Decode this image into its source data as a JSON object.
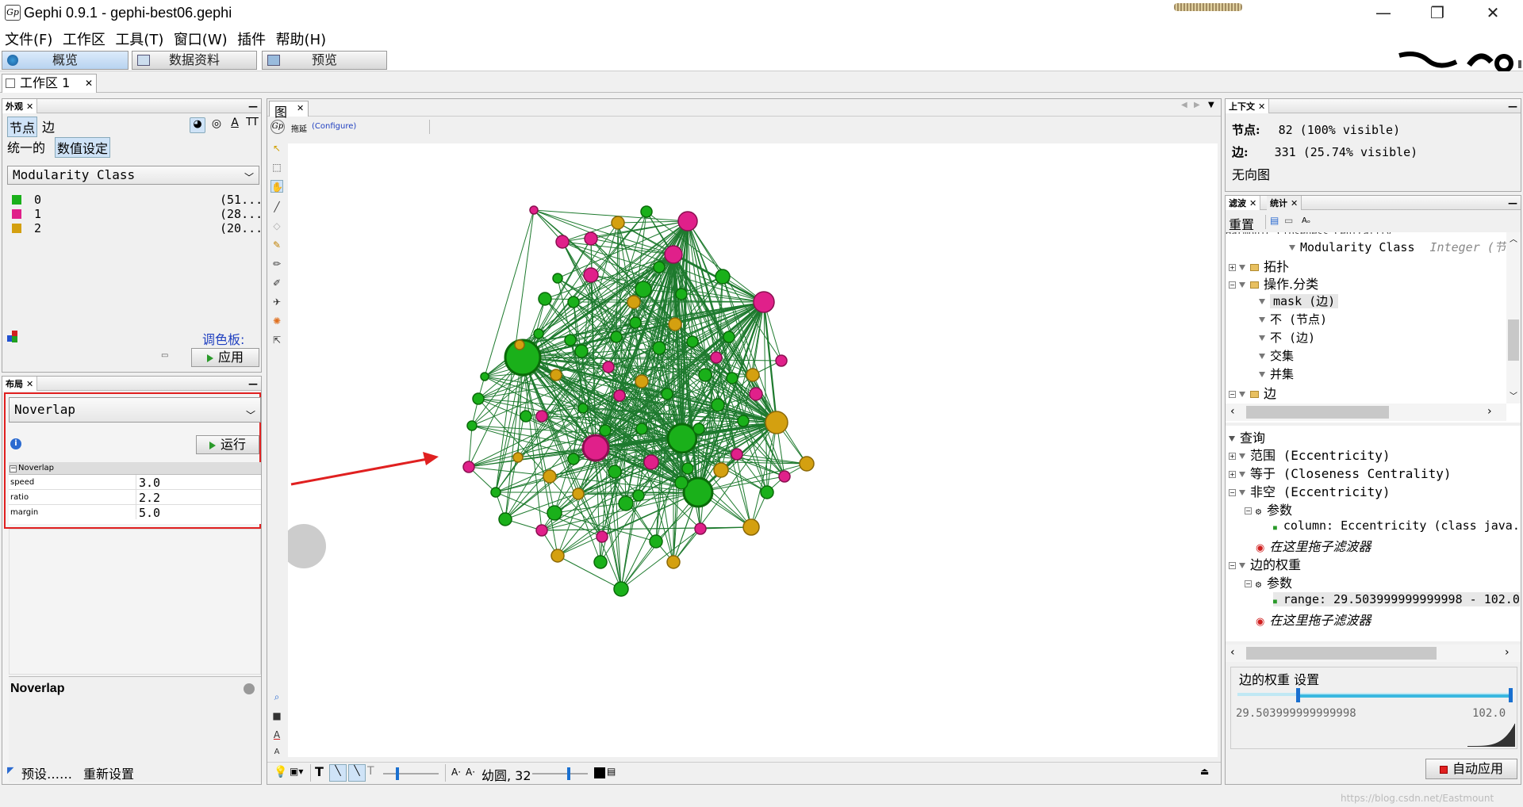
{
  "window": {
    "title": "Gephi 0.9.1 - gephi-best06.gephi",
    "minimize": "—",
    "maximize": "❐",
    "close": "✕"
  },
  "menu": [
    "文件(F)",
    "工作区",
    "工具(T)",
    "窗口(W)",
    "插件",
    "帮助(H)"
  ],
  "top_tabs": {
    "overview": "概览",
    "data": "数据资料",
    "preview": "预览"
  },
  "workspace_tab": "工作区 1",
  "appearance": {
    "title": "外观",
    "tab_nodes": "节点",
    "tab_edges": "边",
    "mode_unique": "统一的",
    "mode_partition": "数值设定",
    "attribute": "Modularity Class",
    "partitions": [
      {
        "label": "0",
        "value": "(51...",
        "color": "#1ab01a"
      },
      {
        "label": "1",
        "value": "(28...",
        "color": "#e0208a"
      },
      {
        "label": "2",
        "value": "(20...",
        "color": "#d4a010"
      }
    ],
    "palette_label": "调色板:",
    "apply": "应用"
  },
  "layout": {
    "title": "布局",
    "algorithm": "Noverlap",
    "run": "运行",
    "group": "Noverlap",
    "params": [
      {
        "name": "speed",
        "value": "3.0"
      },
      {
        "name": "ratio",
        "value": "2.2"
      },
      {
        "name": "margin",
        "value": "5.0"
      }
    ],
    "desc_title": "Noverlap",
    "presets": "预设……",
    "reset": "重新设置"
  },
  "graph": {
    "tab": "图",
    "drag_label": "拖延",
    "configure": "(Configure)",
    "label_font": "幼圆, 32"
  },
  "context": {
    "title": "上下文",
    "nodes_label": "节点:",
    "nodes_value": "82 (100% visible)",
    "edges_label": "边:",
    "edges_value": "331 (25.74% visible)",
    "graph_type": "无向图"
  },
  "filters": {
    "tab_filters": "滤波",
    "tab_stats": "统计",
    "reset": "重置",
    "library": [
      {
        "text": "Modularity Class",
        "suffix": "Integer (节点",
        "indent": 2,
        "kind": "leaf"
      },
      {
        "text": "拓扑",
        "indent": 0,
        "kind": "folder"
      },
      {
        "text": "操作.分类",
        "indent": 0,
        "kind": "folder-open"
      },
      {
        "text": "mask (边)",
        "indent": 1,
        "kind": "leaf"
      },
      {
        "text": "不 (节点)",
        "indent": 1,
        "kind": "leaf"
      },
      {
        "text": "不 (边)",
        "indent": 1,
        "kind": "leaf"
      },
      {
        "text": "交集",
        "indent": 1,
        "kind": "leaf"
      },
      {
        "text": "并集",
        "indent": 1,
        "kind": "leaf"
      },
      {
        "text": "边",
        "indent": 0,
        "kind": "folder"
      }
    ],
    "queries": [
      {
        "text": "查询",
        "indent": 0,
        "kind": "root"
      },
      {
        "text": "范围 (Eccentricity)",
        "indent": 0,
        "kind": "filter"
      },
      {
        "text": "等于 (Closeness Centrality)",
        "indent": 0,
        "kind": "filter"
      },
      {
        "text": "非空 (Eccentricity)",
        "indent": 0,
        "kind": "filter"
      },
      {
        "text": "参数",
        "indent": 1,
        "kind": "params"
      },
      {
        "text": "column: Eccentricity (class java.",
        "indent": 2,
        "kind": "value"
      },
      {
        "text": "在这里拖子滤波器",
        "indent": 1,
        "kind": "drop"
      },
      {
        "text": "边的权重",
        "indent": 0,
        "kind": "filter"
      },
      {
        "text": "参数",
        "indent": 1,
        "kind": "params"
      },
      {
        "text": "range: 29.503999999999998 - 102.0",
        "indent": 2,
        "kind": "value"
      },
      {
        "text": "在这里拖子滤波器",
        "indent": 1,
        "kind": "drop"
      }
    ],
    "settings_title": "边的权重 设置",
    "range_min": "29.503999999999998",
    "range_max": "102.0",
    "auto_apply": "自动应用"
  },
  "watermark": "https://blog.csdn.net/Eastmount"
}
